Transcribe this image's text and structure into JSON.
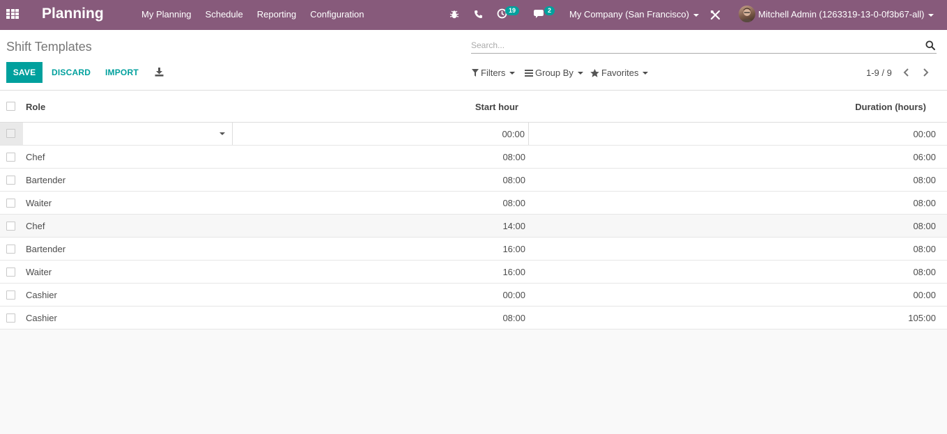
{
  "navbar": {
    "brand": "Planning",
    "menu": [
      "My Planning",
      "Schedule",
      "Reporting",
      "Configuration"
    ],
    "activity_count": "19",
    "message_count": "2",
    "company": "My Company (San Francisco)",
    "user": "Mitchell Admin (1263319-13-0-0f3b67-all)"
  },
  "control": {
    "breadcrumb": "Shift Templates",
    "search_placeholder": "Search...",
    "save_label": "SAVE",
    "discard_label": "DISCARD",
    "import_label": "IMPORT",
    "filters_label": "Filters",
    "groupby_label": "Group By",
    "favorites_label": "Favorites",
    "pager": "1-9 / 9"
  },
  "table": {
    "columns": [
      "Role",
      "Start hour",
      "Duration (hours)"
    ],
    "edit_row": {
      "role": "",
      "start": "00:00",
      "duration": "00:00"
    },
    "rows": [
      {
        "role": "Chef",
        "start": "08:00",
        "duration": "06:00"
      },
      {
        "role": "Bartender",
        "start": "08:00",
        "duration": "08:00"
      },
      {
        "role": "Waiter",
        "start": "08:00",
        "duration": "08:00"
      },
      {
        "role": "Chef",
        "start": "14:00",
        "duration": "08:00"
      },
      {
        "role": "Bartender",
        "start": "16:00",
        "duration": "08:00"
      },
      {
        "role": "Waiter",
        "start": "16:00",
        "duration": "08:00"
      },
      {
        "role": "Cashier",
        "start": "00:00",
        "duration": "00:00"
      },
      {
        "role": "Cashier",
        "start": "08:00",
        "duration": "105:00"
      }
    ]
  },
  "colors": {
    "brand": "#875a7b",
    "accent": "#00a09d"
  },
  "icons": [
    "apps-grid-icon",
    "bug-icon",
    "phone-icon",
    "clock-icon",
    "chat-icon",
    "tools-icon",
    "search-icon",
    "download-icon",
    "filter-icon",
    "list-icon",
    "star-icon",
    "chevron-left-icon",
    "chevron-right-icon"
  ]
}
